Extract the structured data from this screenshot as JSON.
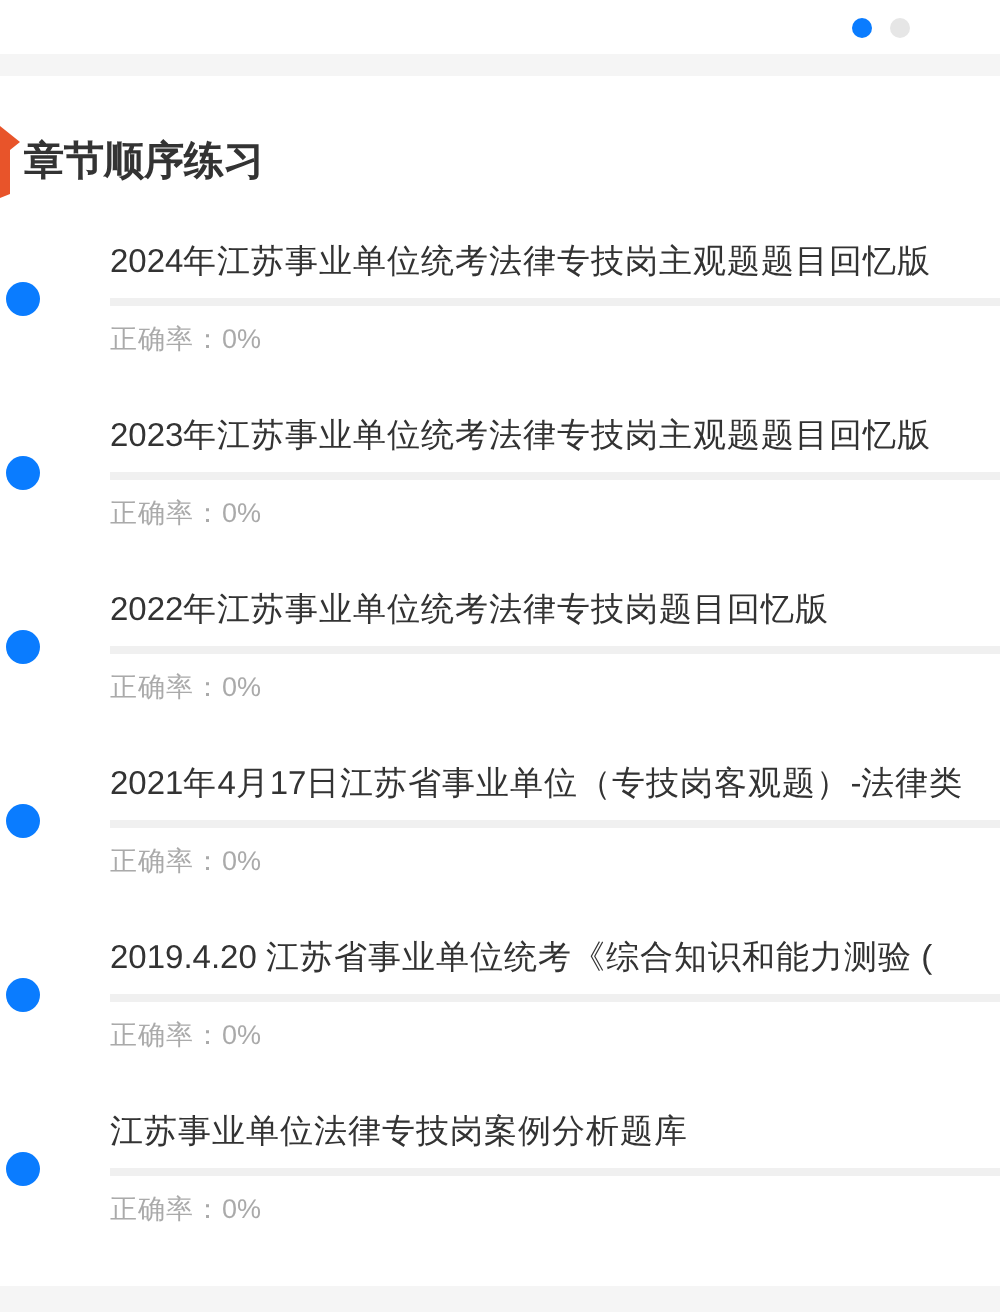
{
  "pager": [
    {
      "selected": true
    },
    {
      "selected": false
    }
  ],
  "section": {
    "title": "章节顺序练习"
  },
  "chapters": [
    {
      "title": "2024年江苏事业单位统考法律专技岗主观题题目回忆版",
      "level": 0,
      "accuracy": "正确率：0%"
    },
    {
      "title": "2023年江苏事业单位统考法律专技岗主观题题目回忆版",
      "level": 0,
      "accuracy": "正确率：0%"
    },
    {
      "title": "2022年江苏事业单位统考法律专技岗题目回忆版",
      "level": 0,
      "accuracy": "正确率：0%"
    },
    {
      "title": "2021年4月17日江苏省事业单位（专技岗客观题）-法律类",
      "level": 0,
      "accuracy": "正确率：0%"
    },
    {
      "title": "2019.4.20 江苏省事业单位统考《综合知识和能力测验 (",
      "level": 0,
      "accuracy": "正确率：0%"
    },
    {
      "title": "江苏事业单位法律专技岗案例分析题库",
      "level": 0,
      "accuracy": "正确率：0%"
    }
  ]
}
